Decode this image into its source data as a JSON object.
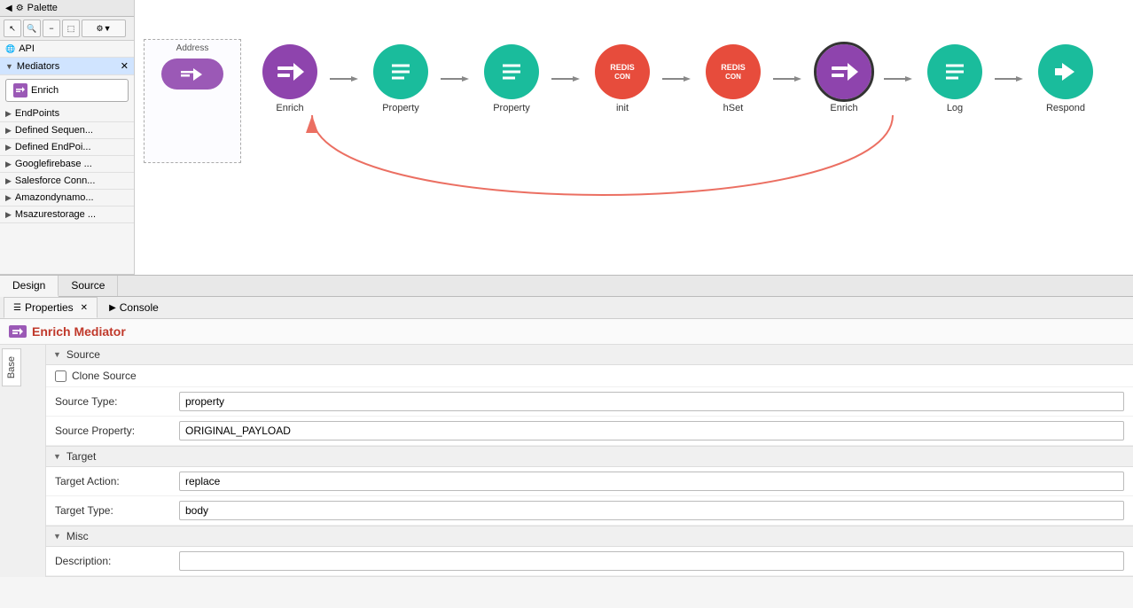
{
  "palette": {
    "title": "Palette",
    "back_icon": "◀",
    "toolbar": {
      "select_tool": "↖",
      "zoom_in": "+",
      "zoom_out": "−",
      "marquee": "⬚",
      "settings": "⚙"
    },
    "categories": [
      {
        "id": "api",
        "label": "API",
        "icon": "🌐",
        "expanded": false
      },
      {
        "id": "mediators",
        "label": "Mediators",
        "icon": "⚙",
        "expanded": true
      },
      {
        "id": "enrich",
        "label": "Enrich",
        "icon": "→□",
        "is_item": true
      },
      {
        "id": "endpoints",
        "label": "EndPoints",
        "icon": "⚙",
        "expanded": false
      },
      {
        "id": "defined_sequences",
        "label": "Defined Sequen...",
        "icon": "⚙",
        "expanded": false
      },
      {
        "id": "defined_endpoints",
        "label": "Defined EndPoi...",
        "icon": "⚙",
        "expanded": false
      },
      {
        "id": "googlefirebase",
        "label": "Googlefirebase ...",
        "icon": "⚙",
        "expanded": false
      },
      {
        "id": "salesforce",
        "label": "Salesforce Conn...",
        "icon": "⚙",
        "expanded": false
      },
      {
        "id": "amazondynamo",
        "label": "Amazondynamo...",
        "icon": "⚙",
        "expanded": false
      },
      {
        "id": "msazurestorage",
        "label": "Msazurestorage ...",
        "icon": "⚙",
        "expanded": false
      }
    ]
  },
  "canvas": {
    "address_label": "Address",
    "address_mediator_label": "Address",
    "nodes": [
      {
        "id": "enrich1",
        "type": "enrich",
        "label": "Enrich",
        "color": "purple"
      },
      {
        "id": "property1",
        "type": "property",
        "label": "Property",
        "color": "teal"
      },
      {
        "id": "property2",
        "type": "property",
        "label": "Property",
        "color": "teal"
      },
      {
        "id": "redis_init",
        "type": "redis",
        "label": "init",
        "color": "redis"
      },
      {
        "id": "redis_hset",
        "type": "redis",
        "label": "hSet",
        "color": "redis"
      },
      {
        "id": "enrich2",
        "type": "enrich",
        "label": "Enrich",
        "color": "purple",
        "selected": true
      },
      {
        "id": "log",
        "type": "log",
        "label": "Log",
        "color": "teal"
      },
      {
        "id": "respond",
        "type": "respond",
        "label": "Respond",
        "color": "teal"
      }
    ]
  },
  "bottom_tabs": [
    {
      "id": "design",
      "label": "Design",
      "active": true
    },
    {
      "id": "source",
      "label": "Source",
      "active": false
    }
  ],
  "properties": {
    "tabs": [
      {
        "id": "properties",
        "label": "Properties",
        "icon": "☰",
        "active": true
      },
      {
        "id": "console",
        "label": "Console",
        "icon": "▶",
        "active": false
      }
    ],
    "mediator_title": "Enrich Mediator",
    "sidebar_tabs": [
      {
        "id": "base",
        "label": "Base",
        "active": true
      }
    ],
    "sections": [
      {
        "id": "source",
        "label": "Source",
        "expanded": true,
        "fields": [
          {
            "type": "checkbox",
            "id": "clone_source",
            "label": "Clone Source",
            "checked": false
          },
          {
            "type": "input",
            "id": "source_type",
            "label": "Source Type:",
            "value": "property"
          },
          {
            "type": "input",
            "id": "source_property",
            "label": "Source Property:",
            "value": "ORIGINAL_PAYLOAD"
          }
        ]
      },
      {
        "id": "target",
        "label": "Target",
        "expanded": true,
        "fields": [
          {
            "type": "input",
            "id": "target_action",
            "label": "Target Action:",
            "value": "replace"
          },
          {
            "type": "input",
            "id": "target_type",
            "label": "Target Type:",
            "value": "body"
          }
        ]
      },
      {
        "id": "misc",
        "label": "Misc",
        "expanded": true,
        "fields": [
          {
            "type": "input",
            "id": "description",
            "label": "Description:",
            "value": ""
          }
        ]
      }
    ]
  }
}
